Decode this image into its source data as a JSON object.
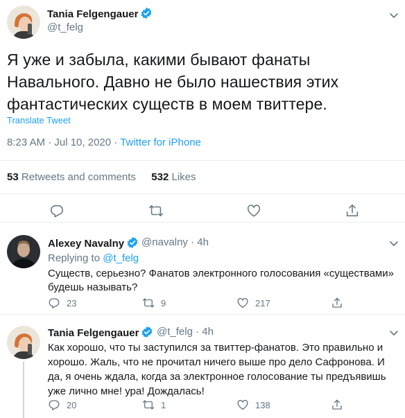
{
  "main_tweet": {
    "author_name": "Tania Felgengauer",
    "author_handle": "@t_felg",
    "text": "Я уже и забыла, какими бывают фанаты Навального. Давно не было нашествия этих фантастических существ в моем твиттере.",
    "translate_label": "Translate Tweet",
    "time": "8:23 AM · Jul 10, 2020 · ",
    "source": "Twitter for iPhone",
    "retweets_count": "53",
    "retweets_label": " Retweets and comments",
    "likes_count": "532",
    "likes_label": " Likes"
  },
  "replies": [
    {
      "author_name": "Alexey Navalny",
      "author_handle": "@navalny",
      "time": " · 4h",
      "replying_prefix": "Replying to ",
      "replying_to": "@t_felg",
      "text": "Существ, серьезно? Фанатов электронного голосования «существами» будешь называть?",
      "reply_count": "23",
      "retweet_count": "9",
      "like_count": "217"
    },
    {
      "author_name": "Tania Felgengauer",
      "author_handle": "@t_felg",
      "time": " · 4h",
      "text": "Как хорошо, что ты заступился за твиттер-фанатов. Это правильно и хорошо. Жаль, что не прочитал ничего выше про дело Сафронова. И да, я очень ждала, когда за электронное голосование ты предъявишь уже лично мне! ура! Дождалась!",
      "reply_count": "20",
      "retweet_count": "1",
      "like_count": "138"
    }
  ],
  "colors": {
    "accent": "#1da1f2",
    "secondary_text": "#657786",
    "divider": "#e6ecf0"
  },
  "icons": [
    "chevron-down-icon",
    "verified-badge-icon",
    "reply-icon",
    "retweet-icon",
    "like-icon",
    "share-icon"
  ]
}
